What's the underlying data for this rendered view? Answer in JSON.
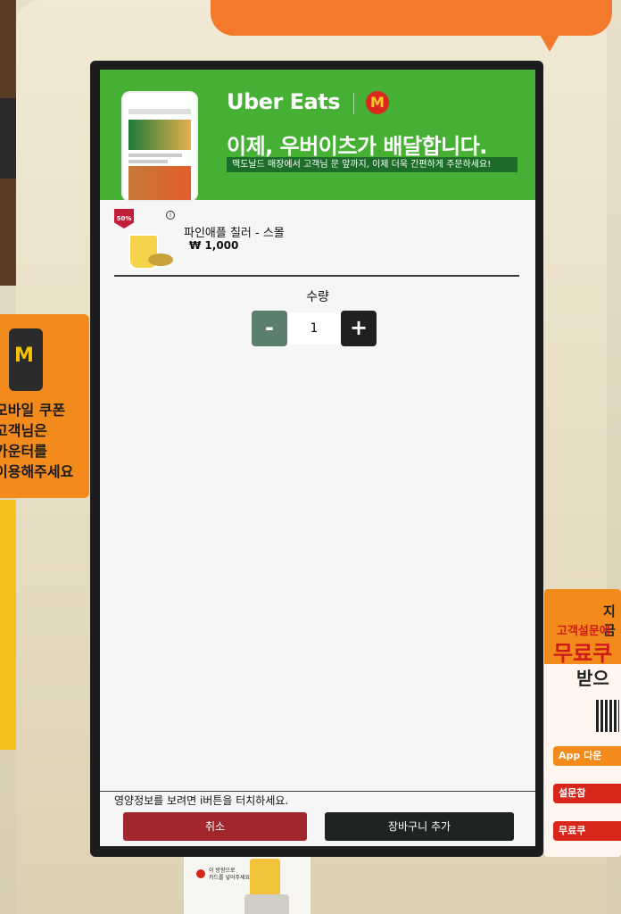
{
  "banner": {
    "brand": "Uber Eats",
    "partner_logo": "M",
    "headline": "이제, 우버이츠가 배달합니다.",
    "subline": "맥도날드 매장에서 고객님 문 앞까지, 이제 더욱 간편하게 주문하세요!"
  },
  "item": {
    "badge": "50%",
    "info_icon": "i",
    "name": "파인애플 칠러 - 스몰",
    "price": "₩ 1,000"
  },
  "quantity": {
    "label": "수량",
    "minus": "-",
    "value": "1",
    "plus": "+"
  },
  "footer": {
    "nutrition_hint": "영양정보를 보려면 i버튼을 터치하세요.",
    "cancel": "취소",
    "add_to_cart": "장바구니 추가"
  },
  "surroundings": {
    "left_sticker": "모바일 쿠폰\n고객님은\n카운터를\n이용해주세요",
    "left_sticker_m": "M",
    "right_poster": {
      "line1": "지금",
      "line2": "고객설문에",
      "line3": "무료쿠",
      "line4": "받으",
      "step1": "App 다운",
      "step2": "설문참",
      "step3": "무료쿠"
    },
    "card_slot_caption": "이 방향으로\n카드를 넣어주세요"
  },
  "colors": {
    "banner_green": "#45b034",
    "cancel_red": "#a1272c",
    "add_cart_dark": "#1f2422",
    "minus_green": "#5b7f6c",
    "kiosk_orange": "#f27a2a"
  }
}
